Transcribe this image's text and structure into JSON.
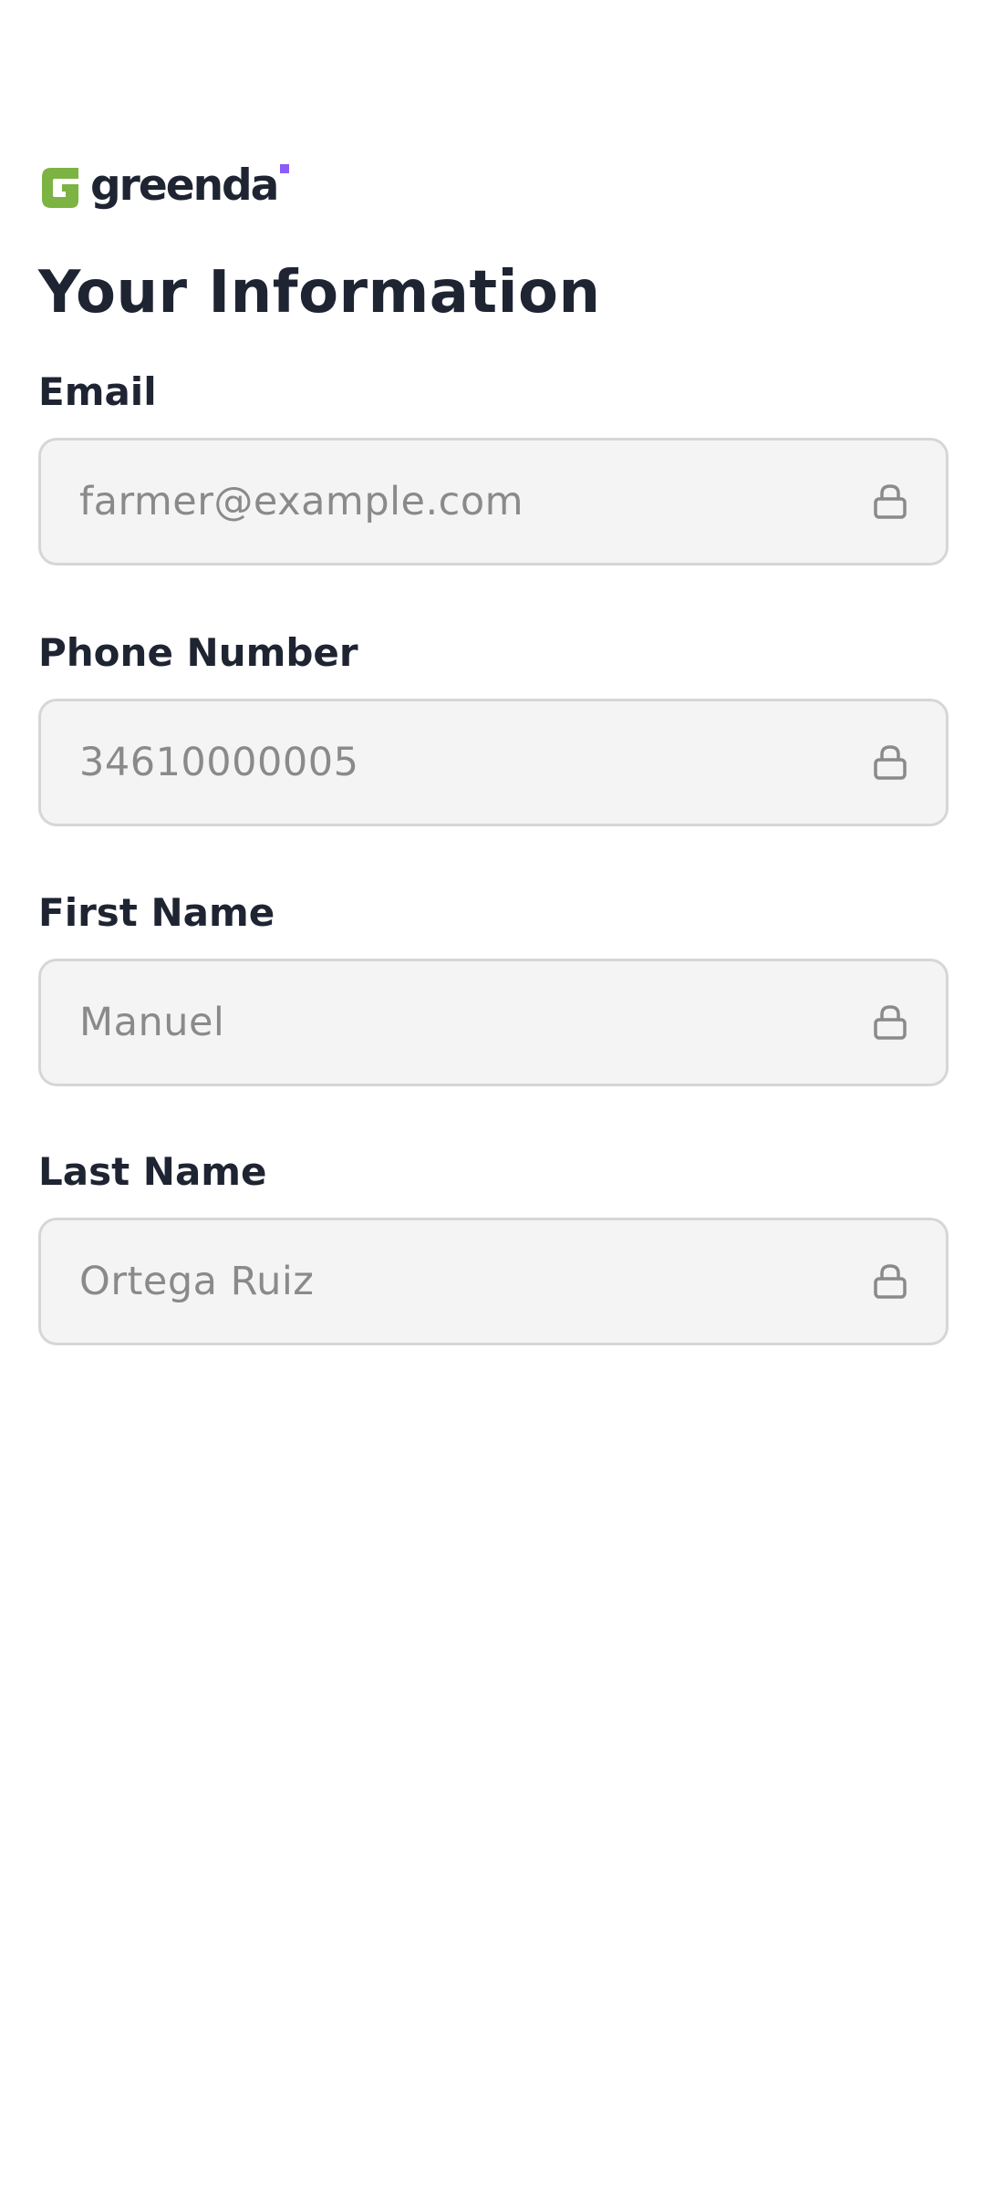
{
  "brand": {
    "name": "greenda",
    "mark_color": "#7cb342",
    "accent_color": "#8b5cf6",
    "text_color": "#1f2433"
  },
  "page": {
    "title": "Your Information"
  },
  "fields": {
    "email": {
      "label": "Email",
      "value": "farmer@example.com",
      "icon": "lock-icon",
      "locked": true
    },
    "phone": {
      "label": "Phone Number",
      "value": "34610000005",
      "icon": "lock-icon",
      "locked": true
    },
    "first_name": {
      "label": "First Name",
      "value": "Manuel",
      "icon": "lock-icon",
      "locked": true
    },
    "last_name": {
      "label": "Last Name",
      "value": "Ortega Ruiz",
      "icon": "lock-icon",
      "locked": true
    }
  }
}
